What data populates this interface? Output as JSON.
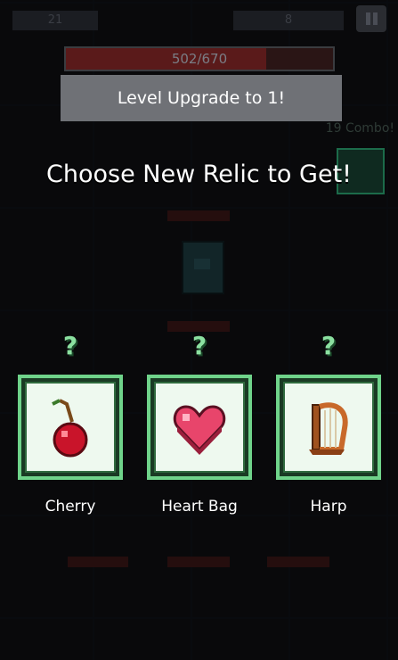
{
  "hud": {
    "left_value": "21",
    "right_value": "8"
  },
  "hp": {
    "text": "502/670",
    "current": 502,
    "max": 670
  },
  "banner": {
    "text": "Level Upgrade to 1!"
  },
  "combo": {
    "text": "19 Combo!"
  },
  "title": "Choose New Relic to Get!",
  "relics": [
    {
      "mark": "?",
      "name": "Cherry",
      "icon": "cherry-icon"
    },
    {
      "mark": "?",
      "name": "Heart Bag",
      "icon": "heart-icon"
    },
    {
      "mark": "?",
      "name": "Harp",
      "icon": "harp-icon"
    }
  ],
  "colors": {
    "frame": "#6fd38a",
    "question": "#8be0a0"
  }
}
